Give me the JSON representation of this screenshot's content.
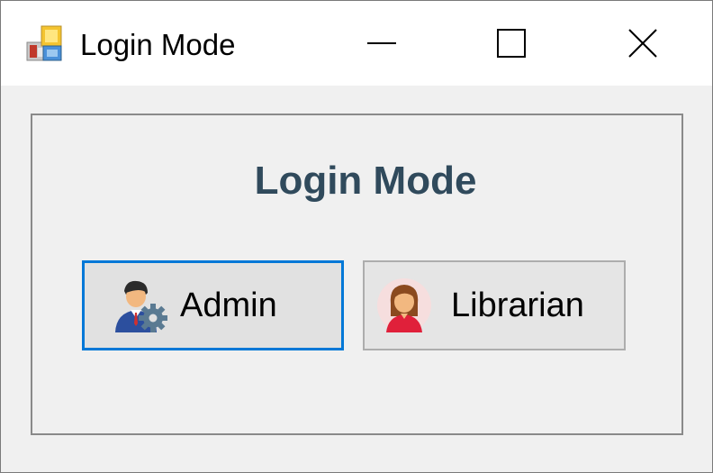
{
  "window": {
    "title": "Login Mode",
    "controls": {
      "minimize": "minimize-icon",
      "maximize": "maximize-icon",
      "close": "close-icon"
    }
  },
  "main": {
    "heading": "Login Mode",
    "buttons": [
      {
        "label": "Admin",
        "icon": "admin-user-gear-icon",
        "focused": true
      },
      {
        "label": "Librarian",
        "icon": "librarian-woman-icon",
        "focused": false
      }
    ]
  },
  "colors": {
    "heading": "#304a5c",
    "focus_border": "#0078d7",
    "button_face": "#e1e1e1",
    "window_background": "#f0f0f0"
  }
}
